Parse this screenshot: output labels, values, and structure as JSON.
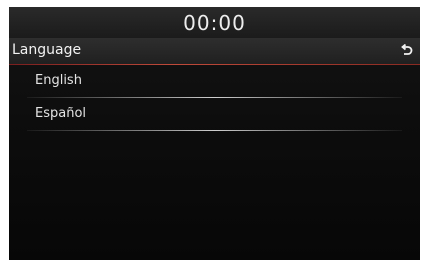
{
  "status_bar": {
    "clock": "00:00"
  },
  "header": {
    "title": "Language",
    "back_icon": "back-arrow-icon"
  },
  "languages": [
    {
      "label": "English"
    },
    {
      "label": "Español"
    }
  ],
  "colors": {
    "accent_rule": "#c04a3a",
    "background": "#0d0d0d",
    "text": "#e8e8e8"
  }
}
